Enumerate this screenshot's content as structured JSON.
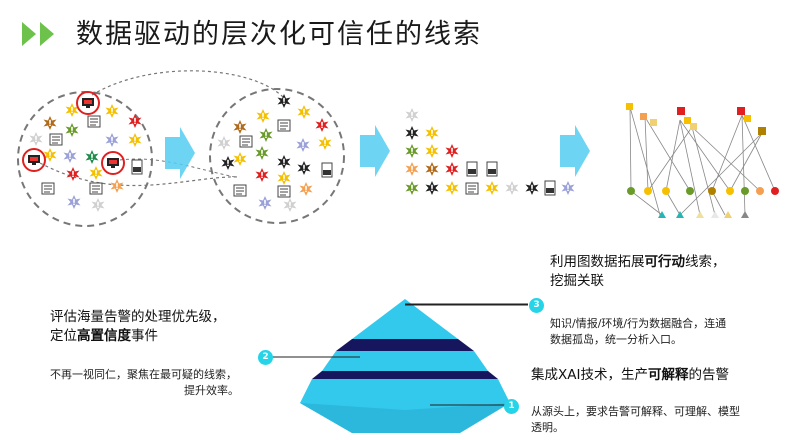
{
  "title": "数据驱动的层次化可信任的线索",
  "colors": {
    "accent_green": "#6cc24a",
    "arrow_cyan": "#55ccf2",
    "pyramid_light": "#33c9ec",
    "pyramid_dark": "#16165f",
    "badge": "#26d4e8"
  },
  "icons": {
    "alert": "alert-badge-icon",
    "document": "document-icon",
    "log": "log-file-icon",
    "monitor": "monitor-icon"
  },
  "levels": {
    "level3": {
      "number": "3",
      "heading_pre": "利用图数据拓展",
      "heading_bold": "可行动",
      "heading_post": "线索，",
      "heading_line2": "挖掘关联",
      "detail_line1": "知识/情报/环境/行为数据融合，连通",
      "detail_line2": "数据孤岛，统一分析入口。"
    },
    "level2": {
      "number": "2",
      "heading_line1": "评估海量告警的处理优先级，",
      "heading_pre": "定位",
      "heading_bold": "高置信度",
      "heading_post": "事件",
      "detail_line1": "不再一视同仁，聚焦在最可疑的线索，",
      "detail_line2": "提升效率。"
    },
    "level1": {
      "number": "1",
      "heading_pre": "集成XAI技术，生产",
      "heading_bold": "可解释",
      "heading_post": "的告警",
      "detail_line1": "从源头上，要求告警可解释、可理解、模型",
      "detail_line2": "透明。"
    }
  }
}
